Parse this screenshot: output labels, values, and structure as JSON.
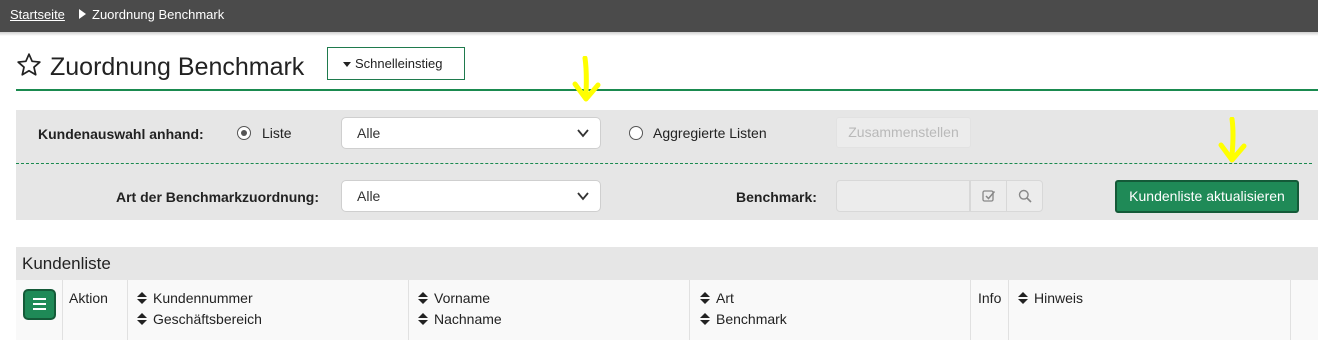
{
  "breadcrumb": {
    "home": "Startseite",
    "current": "Zuordnung Benchmark"
  },
  "page": {
    "title": "Zuordnung Benchmark",
    "quick_access": "Schnelleinstieg"
  },
  "filters": {
    "customer_selection_label": "Kundenauswahl anhand:",
    "radio_list_label": "Liste",
    "radio_list_checked": true,
    "list_select_value": "Alle",
    "radio_aggregated_label": "Aggregierte Listen",
    "radio_aggregated_checked": false,
    "compose_button": "Zusammenstellen",
    "assignment_type_label": "Art der Benchmarkzuordnung:",
    "assignment_type_value": "Alle",
    "benchmark_label": "Benchmark:",
    "benchmark_value": "",
    "refresh_button": "Kundenliste aktualisieren"
  },
  "customer_list": {
    "title": "Kundenliste",
    "columns": {
      "action": "Aktion",
      "customer_number": "Kundennummer",
      "business_unit": "Geschäftsbereich",
      "first_name": "Vorname",
      "last_name": "Nachname",
      "type": "Art",
      "benchmark": "Benchmark",
      "info": "Info",
      "note": "Hinweis"
    }
  },
  "colors": {
    "accent": "#1f8a57",
    "topbar": "#4b4b4b",
    "annotation_arrow": "#ffff00"
  },
  "icons": [
    "star-icon",
    "caret-down-icon",
    "chevron-down-icon",
    "check-square-icon",
    "search-icon",
    "hamburger-menu-icon",
    "sort-icon",
    "annotation-arrow-icon"
  ]
}
